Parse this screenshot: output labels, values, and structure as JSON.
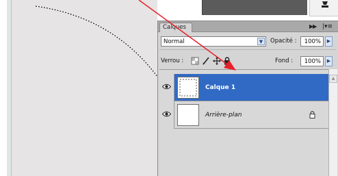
{
  "panel": {
    "tab_label": "Calques",
    "collapse_icon": "double-arrow-right-icon",
    "menu_icon": "panel-menu-icon"
  },
  "blend_mode": {
    "value": "Normal"
  },
  "opacity": {
    "label": "Opacité :",
    "value": "100%"
  },
  "lock": {
    "label": "Verrou :",
    "icons": [
      "lock-transparency-icon",
      "lock-image-brush-icon",
      "lock-position-move-icon",
      "lock-all-padlock-icon"
    ]
  },
  "fill": {
    "label": "Fond :",
    "value": "100%"
  },
  "layers": [
    {
      "name": "Calque 1",
      "selected": true,
      "visible": true,
      "locked": false
    },
    {
      "name": "Arrière-plan",
      "selected": false,
      "visible": true,
      "locked": true
    }
  ],
  "colors": {
    "selection": "#316ac5",
    "panel_bg": "#d5d5d5",
    "panel_header": "#a9a9a9",
    "canvas": "#e6e4e4",
    "guide": "#6fe0e8",
    "annotation_arrow": "#e8202a"
  }
}
